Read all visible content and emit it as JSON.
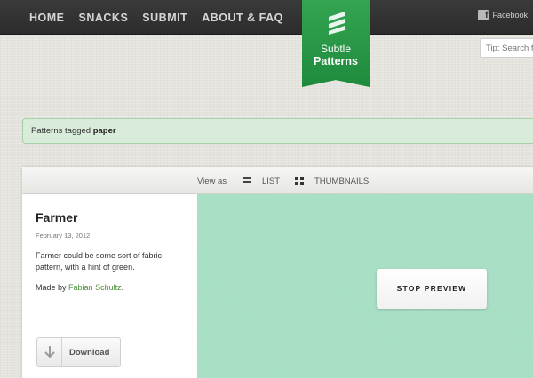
{
  "nav": {
    "items": [
      {
        "label": "HOME"
      },
      {
        "label": "SNACKS"
      },
      {
        "label": "SUBMIT"
      },
      {
        "label": "ABOUT & FAQ"
      }
    ],
    "facebook_label": "Facebook",
    "facebook_icon": "facebook-icon"
  },
  "logo": {
    "line1": "Subtle",
    "line2": "Patterns",
    "mark_icon": "stacked-bars-icon",
    "color": "#2a9a48"
  },
  "search": {
    "placeholder": "Tip: Search f"
  },
  "tag_banner": {
    "prefix": "Patterns tagged",
    "tag": "paper",
    "color": "#d9ecd9"
  },
  "viewbar": {
    "view_as": "View as",
    "list_label": "LIST",
    "thumbnails_label": "THUMBNAILS",
    "list_icon": "list-icon",
    "thumbnails_icon": "grid-icon"
  },
  "pattern": {
    "title": "Farmer",
    "date": "February 13, 2012",
    "description": "Farmer could be some sort of fabric pattern, with a hint of green.",
    "made_by_prefix": "Made by",
    "author": "Fabian Schultz",
    "made_by_suffix": ".",
    "download_label": "Download",
    "download_icon": "download-arrow-icon",
    "preview_color": "#a7dfc4",
    "stop_preview_label": "STOP PREVIEW"
  }
}
